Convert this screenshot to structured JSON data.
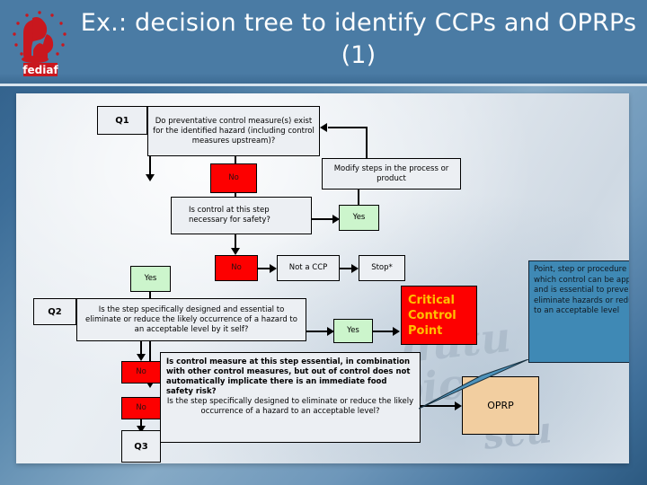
{
  "slide": {
    "title": "Ex.: decision tree to identify CCPs and OPRPs (1)",
    "logo_text": "fediaf",
    "logo_icon": "fediaf-dog-cat-logo"
  },
  "flowchart": {
    "q1_label": "Q1",
    "q1_question": "Do preventative control measure(s) exist for the identified hazard (including control measures upstream)?",
    "q1_yes": "Yes",
    "q1_no": "No",
    "modify_box": "Modify steps in the process or product",
    "control_necessary_question": "Is control at this step necessary for safety?",
    "control_necessary_yes": "Yes",
    "control_necessary_no": "No",
    "not_a_ccp": "Not a CCP",
    "stop": "Stop*",
    "q2_label": "Q2",
    "q2_question": "Is the step specifically designed and essential to eliminate or reduce the likely occurrence of a hazard to an acceptable level by it self?",
    "q2_yes": "Yes",
    "q2_no": "No",
    "q3_no": "No",
    "q3_label": "Q3",
    "q3_question_bold": "Is control measure at this step essential, in combination with other control measures, but out of control does not automatically implicate there is an immediate food safety risk?",
    "q3_question_normal": "Is the step specifically designed to eliminate or reduce the likely occurrence of a hazard to an acceptable level?",
    "ccp_result": "Critical Control Point",
    "oprp_result": "OPRP"
  },
  "callout": {
    "text": "Point, step or procedure at  which control can be applied and is essential to prevent or eliminate hazards or reduce it to an acceptable level"
  },
  "watermark": {
    "line1": "dutu",
    "line2": "pic",
    "line3": "scu"
  },
  "colors": {
    "title_bar": "#4a7ba4",
    "no_box": "#fd0000",
    "yes_box": "#ccf5cc",
    "ccp_box": "#fd0000",
    "ccp_text": "#ffc000",
    "oprp_box": "#f2cea0",
    "callout": "#3f89b5"
  }
}
